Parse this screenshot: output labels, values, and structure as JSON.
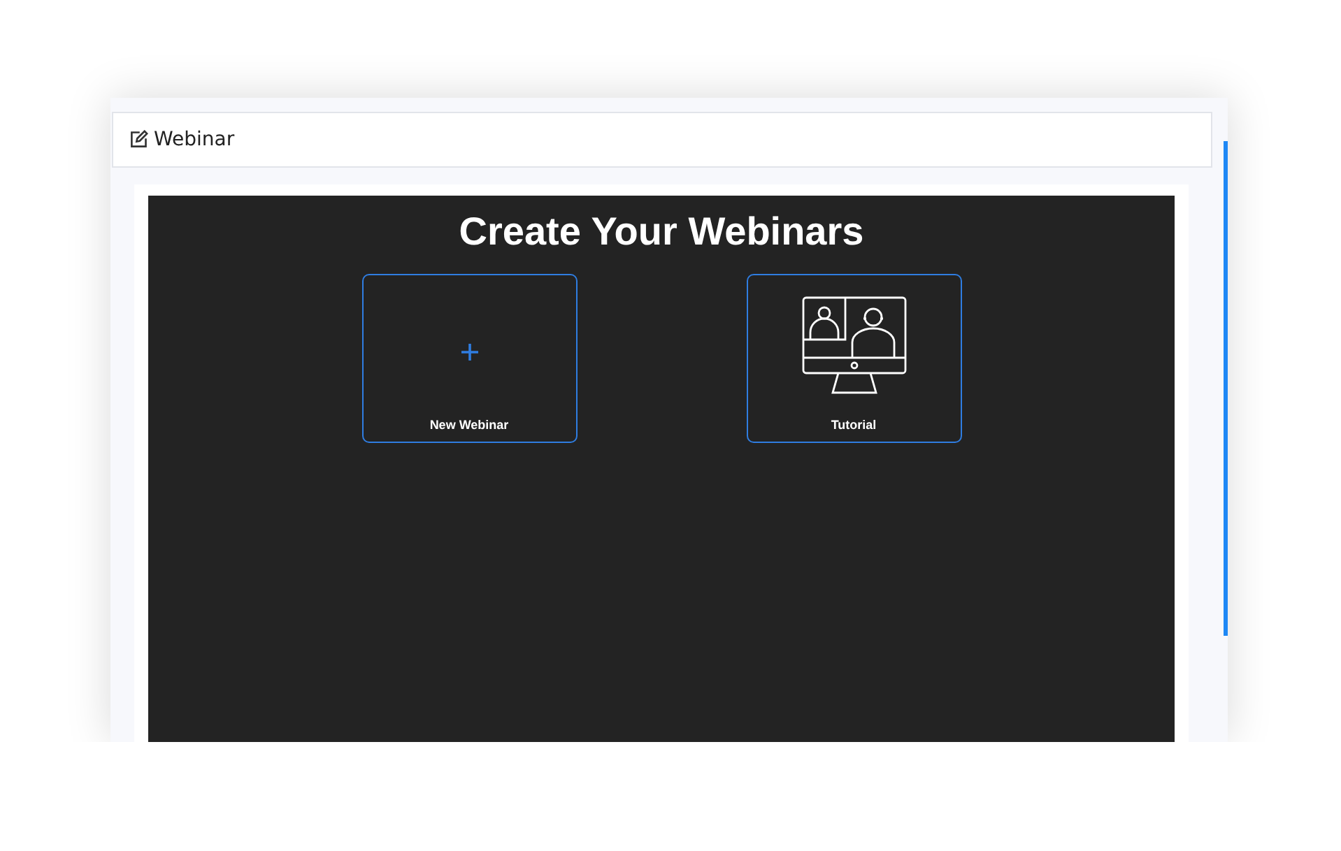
{
  "header": {
    "title": "Webinar"
  },
  "heading": "Create Your Webinars",
  "cards": [
    {
      "kind": "new",
      "label": "New Webinar"
    },
    {
      "kind": "tutorial",
      "label": "Tutorial"
    }
  ]
}
